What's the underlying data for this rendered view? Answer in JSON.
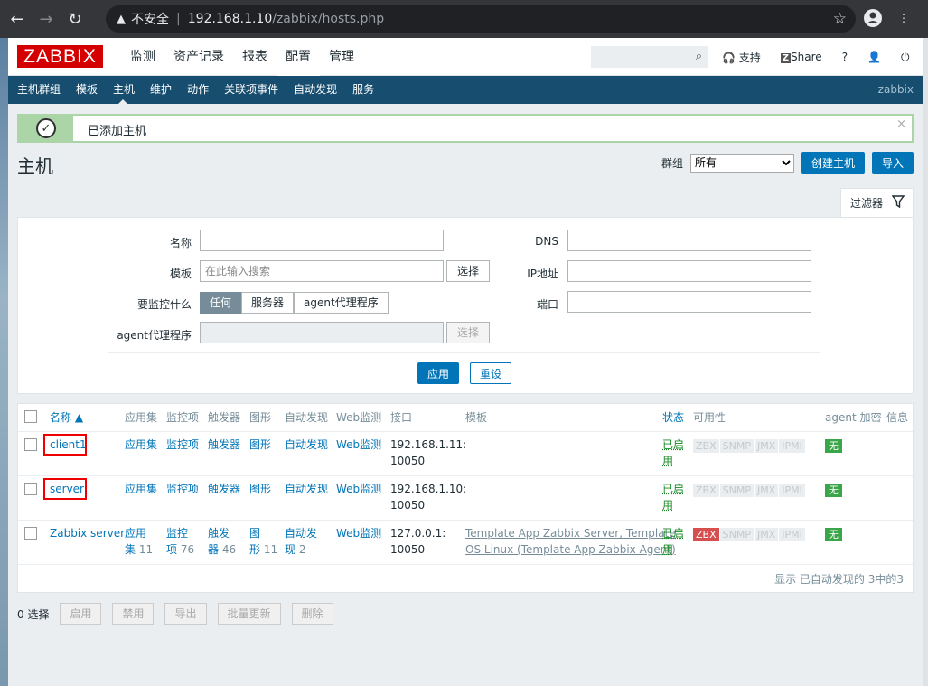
{
  "browser": {
    "warning": "不安全",
    "host": "192.168.1.10",
    "path": "/zabbix/hosts.php"
  },
  "nav": {
    "logo": "ZABBIX",
    "menu": [
      "监测",
      "资产记录",
      "报表",
      "配置",
      "管理"
    ],
    "selected": "配置",
    "support": "支持",
    "share": "Share",
    "help": "?"
  },
  "subnav": {
    "items": [
      "主机群组",
      "模板",
      "主机",
      "维护",
      "动作",
      "关联项事件",
      "自动发现",
      "服务"
    ],
    "right": "zabbix"
  },
  "message": "已添加主机",
  "page": {
    "title": "主机",
    "group_label": "群组",
    "group_value": "所有",
    "create_btn": "创建主机",
    "import_btn": "导入"
  },
  "filter": {
    "tab": "过滤器",
    "name_label": "名称",
    "template_label": "模板",
    "template_placeholder": "在此输入搜索",
    "select": "选择",
    "monitor_label": "要监控什么",
    "monitor_options": [
      "任何",
      "服务器",
      "agent代理程序"
    ],
    "proxy_label": "agent代理程序",
    "dns_label": "DNS",
    "ip_label": "IP地址",
    "port_label": "端口",
    "apply": "应用",
    "reset": "重设"
  },
  "table": {
    "headers": [
      "名称 ▲",
      "应用集",
      "监控项",
      "触发器",
      "图形",
      "自动发现",
      "Web监测",
      "接口",
      "模板",
      "状态",
      "可用性",
      "agent 加密",
      "信息"
    ],
    "rows": [
      {
        "name": "client1",
        "app": "应用集",
        "items": "监控项",
        "triggers": "触发器",
        "graphs": "图形",
        "discovery": "自动发现",
        "web": "Web监测",
        "iface": "192.168.1.11:",
        "port": "10050",
        "templates": "",
        "status1": "已启",
        "status2": "用",
        "enc": "无"
      },
      {
        "name": "server",
        "app": "应用集",
        "items": "监控项",
        "triggers": "触发器",
        "graphs": "图形",
        "discovery": "自动发现",
        "web": "Web监测",
        "iface": "192.168.1.10:",
        "port": "10050",
        "templates": "",
        "status1": "已启",
        "status2": "用",
        "enc": "无"
      },
      {
        "name": "Zabbix server",
        "app1": "应用",
        "app2": "集",
        "app_n": "11",
        "items1": "监控",
        "items2": "项",
        "items_n": "76",
        "trig1": "触发",
        "trig2": "器",
        "trig_n": "46",
        "gr1": "图",
        "gr2": "形",
        "gr_n": "11",
        "disc1": "自动发",
        "disc2": "现",
        "disc_n": "2",
        "web": "Web监测",
        "iface": "127.0.0.1:",
        "port": "10050",
        "tpl1": "Template App Zabbix Server, Template",
        "tpl2": "OS Linux (Template App Zabbix Agent)",
        "status1": "已启",
        "status2": "用",
        "enc": "无"
      }
    ],
    "avail": [
      "ZBX",
      "SNMP",
      "JMX",
      "IPMI"
    ],
    "footer": "显示 已自动发现的 3中的3"
  },
  "actions": {
    "selected": "0 选择",
    "buttons": [
      "启用",
      "禁用",
      "导出",
      "批量更新",
      "删除"
    ]
  }
}
